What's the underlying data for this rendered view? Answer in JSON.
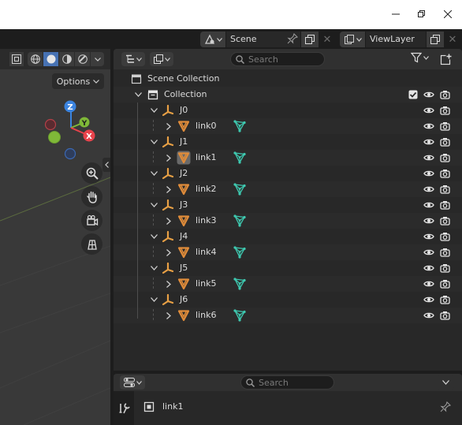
{
  "window": {
    "minimize_icon": "minimize-icon",
    "maximize_icon": "maximize-icon",
    "close_icon": "close-icon"
  },
  "topbar": {
    "scene_label": "Scene",
    "viewlayer_label": "ViewLayer"
  },
  "viewport": {
    "options_label": "Options",
    "gizmo": {
      "z": "Z",
      "y": "Y",
      "x": "X"
    },
    "tools": [
      "zoom-icon",
      "hand-pan-icon",
      "camera-view-icon",
      "grid-ortho-icon"
    ]
  },
  "outliner": {
    "search_placeholder": "Search",
    "scene_collection": "Scene Collection",
    "collection": "Collection",
    "items": [
      {
        "joint": "J0",
        "link": "link0"
      },
      {
        "joint": "J1",
        "link": "link1"
      },
      {
        "joint": "J2",
        "link": "link2"
      },
      {
        "joint": "J3",
        "link": "link3"
      },
      {
        "joint": "J4",
        "link": "link4"
      },
      {
        "joint": "J5",
        "link": "link5"
      },
      {
        "joint": "J6",
        "link": "link6"
      }
    ],
    "selected_link": "link1"
  },
  "properties": {
    "search_placeholder": "Search",
    "object_name": "link1"
  },
  "colors": {
    "accent_blue": "#4772b3",
    "armature_orange": "#e8a045",
    "mesh_orange": "#e08c3a",
    "mesh_data_teal": "#3ec9b0",
    "axis_x": "#e8424b",
    "axis_y": "#7fb838",
    "axis_z": "#3b84e0"
  }
}
